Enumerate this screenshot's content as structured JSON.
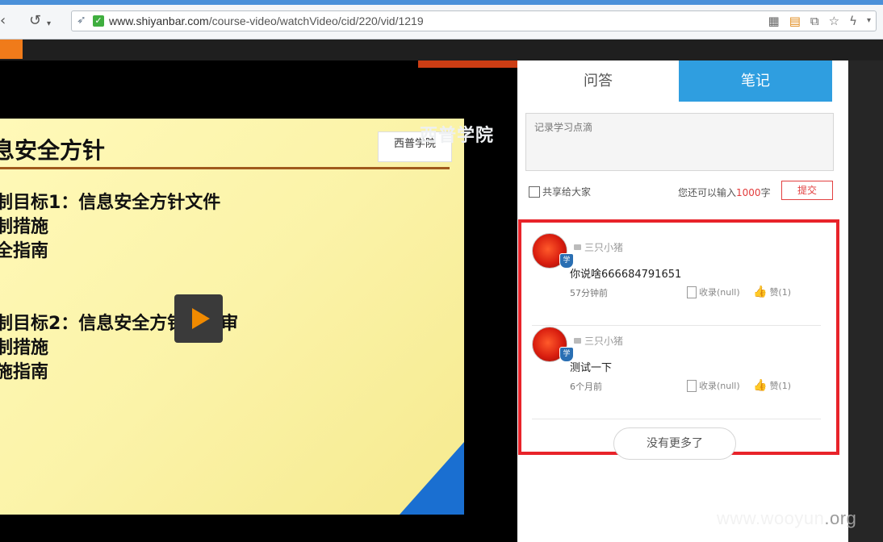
{
  "browser": {
    "url_host": "www.shiyanbar.com",
    "url_path": "/course-video/watchVideo/cid/220/vid/1219",
    "icons": [
      "back-icon",
      "refresh-icon",
      "rocket-icon",
      "secure-icon",
      "qr-icon",
      "reader-icon",
      "translate-icon",
      "star-icon",
      "flash-icon"
    ]
  },
  "video": {
    "slide_title": "息安全方针",
    "slide_logo": "西普学院",
    "watermark": "西普学院",
    "lines": [
      "制目标1：信息安全方针文件",
      "制措施",
      "全指南",
      "制目标2：信息安全方针的评审",
      "制措施",
      "施指南"
    ]
  },
  "panel": {
    "tabs": {
      "qa": "问答",
      "notes": "笔记"
    },
    "note_placeholder": "记录学习点滴",
    "share_label": "共享给大家",
    "hint_prefix": "您还可以输入",
    "hint_count": "1000",
    "hint_suffix": "字",
    "submit_label": "提交",
    "notes": [
      {
        "author": "三只小猪",
        "badge": "学",
        "content": "你说啥666684791651",
        "time": "57分钟前",
        "collect": "收录(null)",
        "like": "赞(1)"
      },
      {
        "author": "三只小猪",
        "badge": "学",
        "content": "测试一下",
        "time": "6个月前",
        "collect": "收录(null)",
        "like": "赞(1)"
      }
    ],
    "no_more": "没有更多了"
  },
  "watermark": {
    "site": "www.wooyun",
    "tld": ".org"
  },
  "colors": {
    "tab_active": "#2f9ee0",
    "highlight": "#e8232a",
    "submit": "#e24040"
  }
}
